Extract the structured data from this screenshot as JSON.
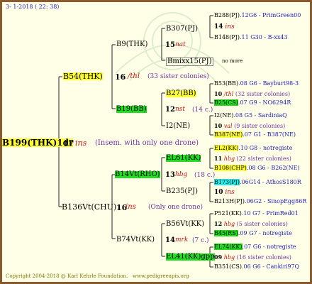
{
  "header": {
    "date": "3-  1-2018 ( 22: 38)"
  },
  "footer": {
    "copyright": "Copyright 2004-2018 @ Karl Kehrle Foundation.",
    "url": "www.pedigreeapis.org"
  },
  "root": {
    "id": "B199(THK)1dr",
    "num": "17",
    "tag": "ins",
    "note": "(Insem. with only one drone)"
  },
  "gen1": {
    "top": {
      "id": "B54(THK)",
      "num": "16",
      "tag": "/thl",
      "note": "(33 sister colonies)"
    },
    "bottom": {
      "id": "B136Vt(CHU)",
      "num": "16",
      "tag": "ins",
      "note": "(Only one drone)"
    }
  },
  "gen2": {
    "a": {
      "id": "B9(THK)",
      "num": "15",
      "tag": "nat"
    },
    "b": {
      "id": "B19(BB)",
      "num": "12",
      "tag": "nst",
      "note": "(14 c.)"
    },
    "c": {
      "id": "B14Vt(RHO)",
      "num": "13",
      "tag": "hbg",
      "note": "(18 c.)"
    },
    "d": {
      "id": "B74Vt(KK)",
      "num": "14",
      "tag": "mrk",
      "note": "(7 c.)"
    }
  },
  "gen3": {
    "a1": {
      "id": "B307(PJ)"
    },
    "a2": {
      "id": "Bmixx15(PJ)",
      "note": "no more"
    },
    "b1": {
      "id": "B27(BB)"
    },
    "b2": {
      "id": "I2(NE)"
    },
    "c1": {
      "id": "EL61(KK)"
    },
    "c2": {
      "id": "B235(PJ)"
    },
    "d1": {
      "id": "B56Vt(KK)"
    },
    "d2": {
      "id": "EL41(KK)gpp"
    }
  },
  "gen4": [
    {
      "id": "B288(PJ)",
      "rest": ".12G6 - PrimGreen00"
    },
    {
      "num": "14",
      "tag": "ins"
    },
    {
      "id": "B148(PJ)",
      "rest": ".11       G30 - B-xx43"
    },
    {
      "id": "B53(BB)",
      "rest": ".08   G6 - Bayburt98-3"
    },
    {
      "num": "10",
      "tag": "/thl",
      "note": "(32 sister colonies)"
    },
    {
      "id": "B25(CS)",
      "rest": ".07       G9 - NO6294R"
    },
    {
      "id": "I2(NE)",
      "rest": ".08        G5 - SardiniaQ"
    },
    {
      "num": "10",
      "tag": "val",
      "note": "(9 sister colonies)"
    },
    {
      "id": "B387(NE)",
      "rest": ".07     G1 - B387(NE)"
    },
    {
      "id": "EL2(KK)",
      "rest": ".10     G8 - notregiste"
    },
    {
      "num": "11",
      "tag": "hbg",
      "note": "(22 sister colonies)"
    },
    {
      "id": "B108(CHP)",
      "rest": ".08    G6 - B262(NE)"
    },
    {
      "id": "B173(PJ)",
      "rest": ".06G14 - AthosS180R"
    },
    {
      "num": "10",
      "tag": "ins"
    },
    {
      "id": "B213H(PJ)",
      "rest": ".06G2 - SinopEgg86R"
    },
    {
      "id": "P521(KK)",
      "rest": ".10   G7 - PrimRed01"
    },
    {
      "num": "12",
      "tag": "hbg",
      "note": "(5 sister colonies)"
    },
    {
      "id": "B45(RS)",
      "rest": ".09      G7 - notregiste"
    },
    {
      "id": "EL74(KK)",
      "rest": ".07    G6 - notregiste"
    },
    {
      "num": "09",
      "tag": "hbg",
      "note": "(16 sister colonies)"
    },
    {
      "id": "B351(CS)",
      "rest": ".06   G6 - Cankiri97Q"
    }
  ],
  "colors": {
    "frame": "#8a5a2e",
    "background": "#ffffe8",
    "yellow": "#ffff33",
    "green": "#22dd22",
    "cyan": "#22eeee",
    "red": "#cc1111",
    "blue": "#2020c0",
    "purple": "#7030a0"
  }
}
